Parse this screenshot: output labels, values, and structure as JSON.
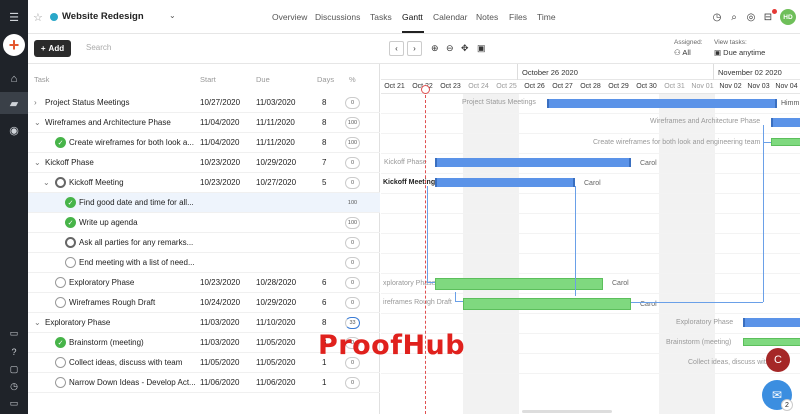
{
  "header": {
    "project_title": "Website Redesign",
    "tabs": [
      "Overview",
      "Discussions",
      "Tasks",
      "Gantt",
      "Calendar",
      "Notes",
      "Files",
      "Time"
    ],
    "active_tab": "Gantt",
    "avatar_initials": "HD"
  },
  "toolbar": {
    "add_label": "Add",
    "search_placeholder": "Search",
    "assigned_label": "Assigned:",
    "assigned_value": "All",
    "view_label": "View tasks:",
    "view_value": "Due anytime"
  },
  "columns": {
    "task": "Task",
    "start": "Start",
    "due": "Due",
    "days": "Days",
    "pct": "%"
  },
  "rows": [
    {
      "name": "Project Status Meetings",
      "start": "10/27/2020",
      "due": "11/03/2020",
      "days": "8",
      "pct": "0"
    },
    {
      "name": "Wireframes and Architecture Phase",
      "start": "11/04/2020",
      "due": "11/11/2020",
      "days": "8",
      "pct": "100"
    },
    {
      "name": "Create wireframes for both look a...",
      "start": "11/04/2020",
      "due": "11/11/2020",
      "days": "8",
      "pct": "100"
    },
    {
      "name": "Kickoff Phase",
      "start": "10/23/2020",
      "due": "10/29/2020",
      "days": "7",
      "pct": "0"
    },
    {
      "name": "Kickoff Meeting",
      "start": "10/23/2020",
      "due": "10/27/2020",
      "days": "5",
      "pct": "0"
    },
    {
      "name": "Find good date and time for all...",
      "start": "",
      "due": "",
      "days": "",
      "pct": "100"
    },
    {
      "name": "Write up agenda",
      "start": "",
      "due": "",
      "days": "",
      "pct": "100"
    },
    {
      "name": "Ask all parties for any remarks...",
      "start": "",
      "due": "",
      "days": "",
      "pct": "0"
    },
    {
      "name": "End meeting with a list of need...",
      "start": "",
      "due": "",
      "days": "",
      "pct": "0"
    },
    {
      "name": "Exploratory Phase",
      "start": "10/23/2020",
      "due": "10/28/2020",
      "days": "6",
      "pct": "0"
    },
    {
      "name": "Wireframes Rough Draft",
      "start": "10/24/2020",
      "due": "10/29/2020",
      "days": "6",
      "pct": "0"
    },
    {
      "name": "Exploratory Phase",
      "start": "11/03/2020",
      "due": "11/10/2020",
      "days": "8",
      "pct": "33"
    },
    {
      "name": "Brainstorm (meeting)",
      "start": "11/03/2020",
      "due": "11/05/2020",
      "days": "3",
      "pct": "0"
    },
    {
      "name": "Collect ideas, discuss with team",
      "start": "11/05/2020",
      "due": "11/05/2020",
      "days": "1",
      "pct": "0"
    },
    {
      "name": "Narrow Down Ideas - Develop Act...",
      "start": "11/06/2020",
      "due": "11/06/2020",
      "days": "1",
      "pct": "0"
    }
  ],
  "gantt": {
    "weeks": [
      "October 26 2020",
      "November 02 2020"
    ],
    "days": [
      "Oct 21",
      "Oct 22",
      "Oct 23",
      "Oct 24",
      "Oct 25",
      "Oct 26",
      "Oct 27",
      "Oct 28",
      "Oct 29",
      "Oct 30",
      "Oct 31",
      "Nov 01",
      "Nov 02",
      "Nov 03",
      "Nov 04"
    ],
    "labels": {
      "psm": "Project Status Meetings",
      "himm": "Himm",
      "wap": "Wireframes and Architecture Phase",
      "cwf": "Create wireframes for both look and engineering team",
      "kp": "Kickoff Phase",
      "carol1": "Carol",
      "km": "Kickoff Meeting",
      "carol2": "Carol",
      "ep": "xploratory Phase",
      "carol3": "Carol",
      "wrd": "ireframes Rough Draft",
      "carol4": "Carol",
      "ep2": "Exploratory Phase",
      "bs": "Brainstorm (meeting)",
      "ci": "Collect ideas, discuss with"
    }
  },
  "watermark": "ProofHub",
  "floating": {
    "user_initial": "C",
    "chat_count": "2"
  },
  "colors": {
    "accent": "#29a7c8",
    "green": "#47b449",
    "bar_blue": "#5b93e8",
    "bar_green": "#7fd97f",
    "watermark": "#e0211d"
  }
}
